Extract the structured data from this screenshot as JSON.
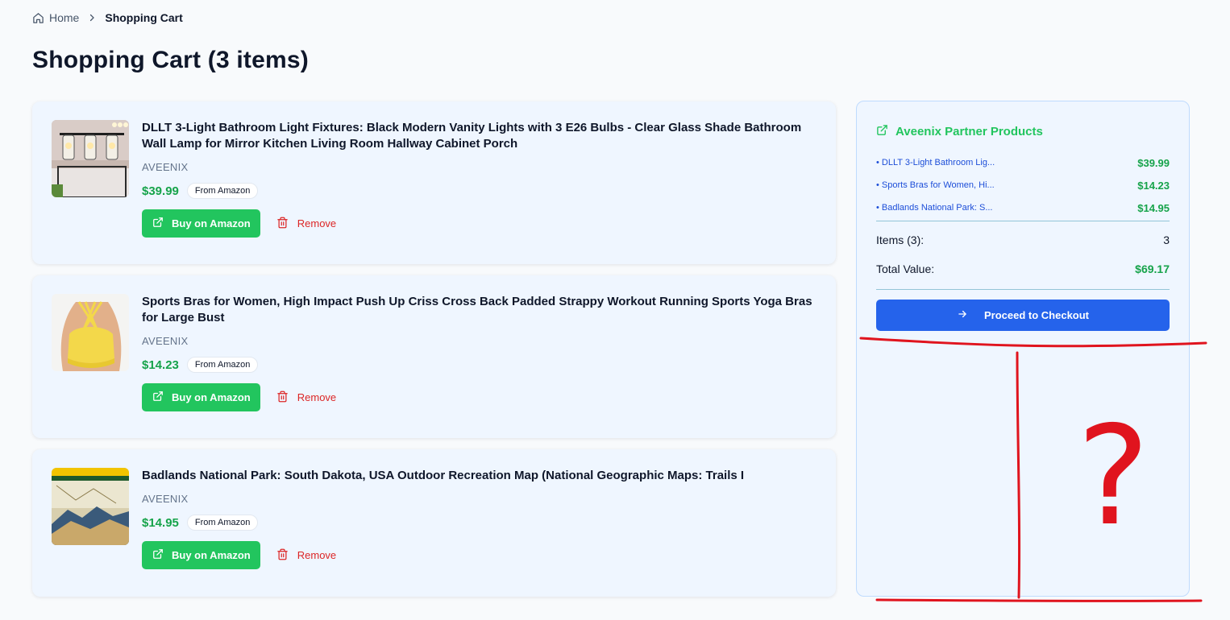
{
  "breadcrumb": {
    "home": "Home",
    "current": "Shopping Cart"
  },
  "page": {
    "title": "Shopping Cart (3 items)"
  },
  "cart": {
    "items": [
      {
        "title": "DLLT 3-Light Bathroom Light Fixtures: Black Modern Vanity Lights with 3 E26 Bulbs - Clear Glass Shade Bathroom Wall Lamp for Mirror Kitchen Living Room Hallway Cabinet Porch",
        "brand": "AVEENIX",
        "price": "$39.99",
        "source": "From Amazon",
        "buy_label": "Buy on Amazon",
        "remove_label": "Remove",
        "thumb_icon": "vanity-light-image"
      },
      {
        "title": "Sports Bras for Women, High Impact Push Up Criss Cross Back Padded Strappy Workout Running Sports Yoga Bras for Large Bust",
        "brand": "AVEENIX",
        "price": "$14.23",
        "source": "From Amazon",
        "buy_label": "Buy on Amazon",
        "remove_label": "Remove",
        "thumb_icon": "sports-bra-image"
      },
      {
        "title": "Badlands National Park: South Dakota, USA Outdoor Recreation Map (National Geographic Maps: Trails I",
        "brand": "AVEENIX",
        "price": "$14.95",
        "source": "From Amazon",
        "buy_label": "Buy on Amazon",
        "remove_label": "Remove",
        "thumb_icon": "trail-map-image"
      }
    ]
  },
  "summary": {
    "header": "Aveenix Partner Products",
    "items": [
      {
        "name": "• DLLT 3-Light Bathroom Lig...",
        "price": "$39.99"
      },
      {
        "name": "• Sports Bras for Women, Hi...",
        "price": "$14.23"
      },
      {
        "name": "• Badlands National Park: S...",
        "price": "$14.95"
      }
    ],
    "items_label": "Items (3):",
    "items_count": "3",
    "total_label": "Total Value:",
    "total_value": "$69.17",
    "checkout_label": "Proceed to Checkout"
  },
  "annotation": {
    "mark": "?"
  },
  "colors": {
    "accent_green": "#22c55e",
    "price_green": "#16a34a",
    "checkout_blue": "#2563eb",
    "remove_red": "#dc2626",
    "annotation_red": "#e0141e"
  }
}
